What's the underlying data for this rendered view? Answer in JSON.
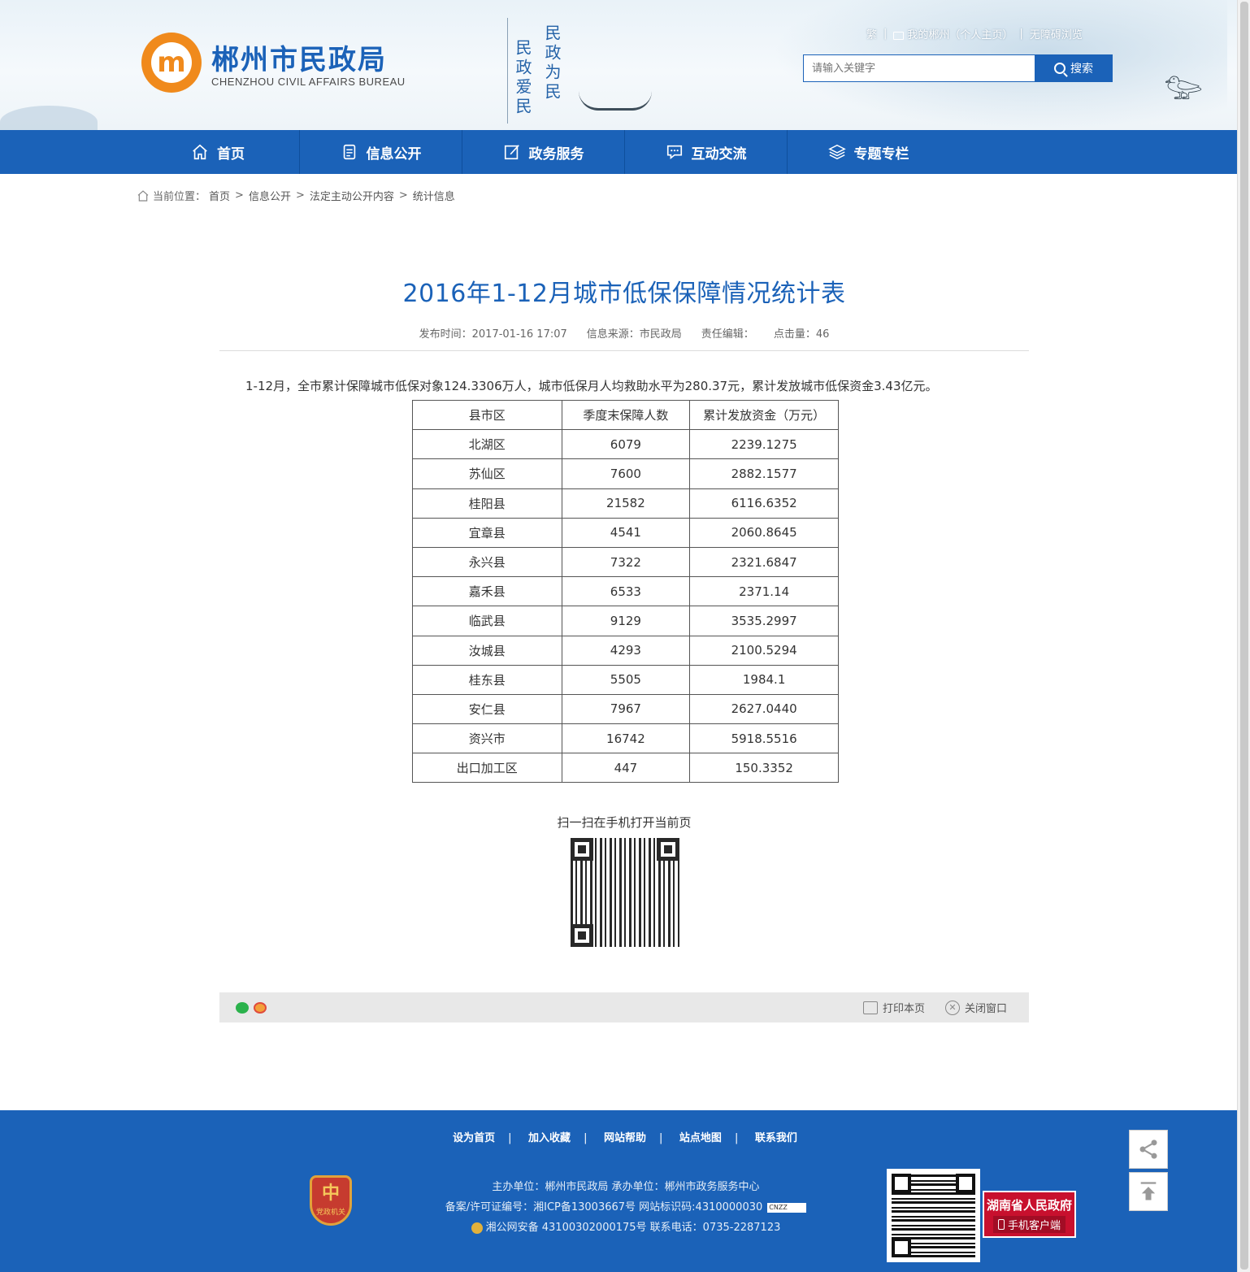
{
  "header": {
    "site_title": "郴州市民政局",
    "site_subtitle": "CHENZHOU CIVIL AFFAIRS BUREAU",
    "logo_glyph": "m",
    "slogan_col1": "民政为民",
    "slogan_col2": "民政爱民",
    "toplinks": {
      "traditional": "繁",
      "my_chenzhou": "我的郴州（个人主页）",
      "accessible": "无障碍浏览"
    },
    "search": {
      "placeholder": "请输入关键字",
      "button_label": "搜索"
    }
  },
  "nav": {
    "items": [
      {
        "label": "首页",
        "icon": "home-icon"
      },
      {
        "label": "信息公开",
        "icon": "document-icon"
      },
      {
        "label": "政务服务",
        "icon": "edit-icon"
      },
      {
        "label": "互动交流",
        "icon": "chat-icon"
      },
      {
        "label": "专题专栏",
        "icon": "layers-icon"
      }
    ]
  },
  "breadcrumb": {
    "prefix": "当前位置：",
    "items": [
      "首页",
      "信息公开",
      "法定主动公开内容",
      "统计信息"
    ],
    "separator": ">"
  },
  "article": {
    "title": "2016年1-12月城市低保保障情况统计表",
    "meta": {
      "published": "发布时间：2017-01-16 17:07",
      "source": "信息来源：市民政局",
      "editor": "责任编辑：",
      "views": "点击量：46"
    },
    "lead": "1-12月，全市累计保障城市低保对象124.3306万人，城市低保月人均救助水平为280.37元，累计发放城市低保资金3.43亿元。",
    "table": {
      "headers": [
        "县市区",
        "季度末保障人数",
        "累计发放资金（万元）"
      ],
      "rows": [
        [
          "北湖区",
          "6079",
          "2239.1275"
        ],
        [
          "苏仙区",
          "7600",
          "2882.1577"
        ],
        [
          "桂阳县",
          "21582",
          "6116.6352"
        ],
        [
          "宜章县",
          "4541",
          "2060.8645"
        ],
        [
          "永兴县",
          "7322",
          "2321.6847"
        ],
        [
          "嘉禾县",
          "6533",
          "2371.14"
        ],
        [
          "临武县",
          "9129",
          "3535.2997"
        ],
        [
          "汝城县",
          "4293",
          "2100.5294"
        ],
        [
          "桂东县",
          "5505",
          "1984.1"
        ],
        [
          "安仁县",
          "7967",
          "2627.0440"
        ],
        [
          "资兴市",
          "16742",
          "5918.5516"
        ],
        [
          "出口加工区",
          "447",
          "150.3352"
        ]
      ]
    },
    "qr_label": "扫一扫在手机打开当前页"
  },
  "toolbar": {
    "print_label": "打印本页",
    "close_label": "关闭窗口"
  },
  "footer": {
    "links": [
      "设为首页",
      "加入收藏",
      "网站帮助",
      "站点地图",
      "联系我们"
    ],
    "line1": "主办单位：郴州市民政局   承办单位：郴州市政务服务中心",
    "line2": "备案/许可证编号：湘ICP备13003667号   网站标识码:4310000030",
    "cnzz": "CNZZ",
    "line3": "湘公网安备 43100302000175号   联系电话：0735-2287123",
    "badge_glyph": "中",
    "badge_text": "党政机关",
    "gov_app_title": "湖南省人民政府",
    "gov_app_sub": "手机客户端"
  },
  "colors": {
    "brand_blue": "#1b62b8",
    "logo_orange": "#f08a1c",
    "gov_red": "#c8102e"
  }
}
